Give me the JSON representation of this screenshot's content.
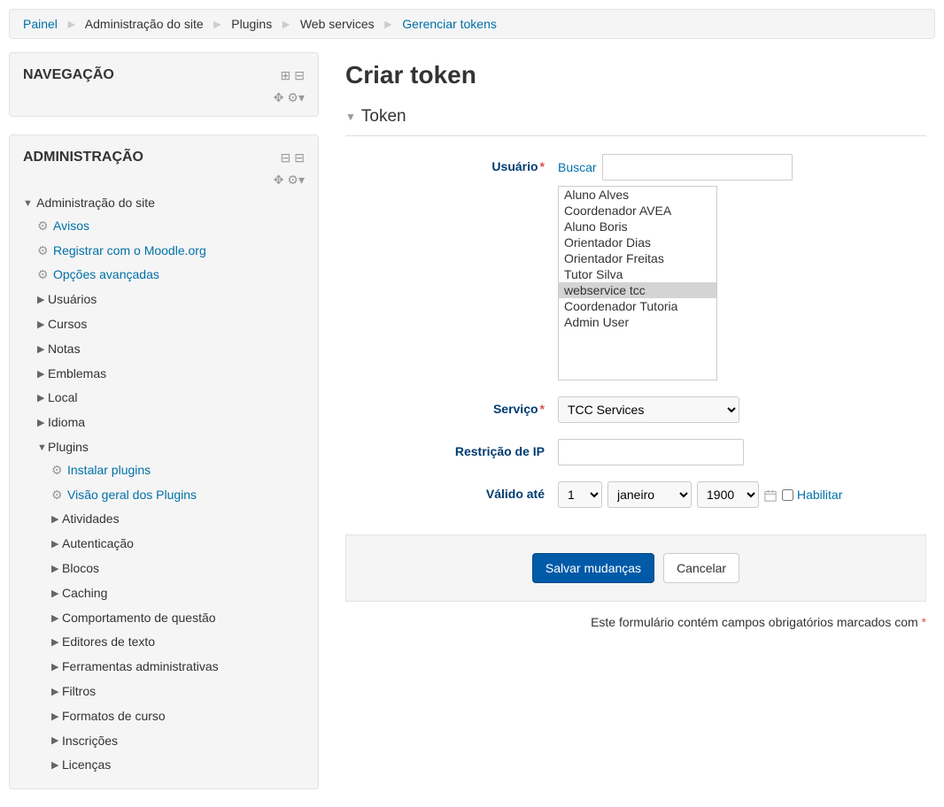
{
  "breadcrumb": [
    {
      "label": "Painel",
      "link": true
    },
    {
      "label": "Administração do site",
      "link": false
    },
    {
      "label": "Plugins",
      "link": false
    },
    {
      "label": "Web services",
      "link": false
    },
    {
      "label": "Gerenciar tokens",
      "link": true
    }
  ],
  "blocks": {
    "navigation": {
      "title": "NAVEGAÇÃO"
    },
    "administration": {
      "title": "ADMINISTRAÇÃO"
    }
  },
  "admin_tree": {
    "root": "Administração do site",
    "items": [
      {
        "label": "Avisos",
        "type": "gear",
        "link": true
      },
      {
        "label": "Registrar com o Moodle.org",
        "type": "gear",
        "link": true
      },
      {
        "label": "Opções avançadas",
        "type": "gear",
        "link": true
      },
      {
        "label": "Usuários",
        "type": "branch",
        "link": false
      },
      {
        "label": "Cursos",
        "type": "branch",
        "link": false
      },
      {
        "label": "Notas",
        "type": "branch",
        "link": false
      },
      {
        "label": "Emblemas",
        "type": "branch",
        "link": false
      },
      {
        "label": "Local",
        "type": "branch",
        "link": false
      },
      {
        "label": "Idioma",
        "type": "branch",
        "link": false
      }
    ],
    "plugins_label": "Plugins",
    "plugins_children": [
      {
        "label": "Instalar plugins",
        "type": "gear",
        "link": true
      },
      {
        "label": "Visão geral dos Plugins",
        "type": "gear",
        "link": true
      },
      {
        "label": "Atividades",
        "type": "branch",
        "link": false
      },
      {
        "label": "Autenticação",
        "type": "branch",
        "link": false
      },
      {
        "label": "Blocos",
        "type": "branch",
        "link": false
      },
      {
        "label": "Caching",
        "type": "branch",
        "link": false
      },
      {
        "label": "Comportamento de questão",
        "type": "branch",
        "link": false
      },
      {
        "label": "Editores de texto",
        "type": "branch",
        "link": false
      },
      {
        "label": "Ferramentas administrativas",
        "type": "branch",
        "link": false
      },
      {
        "label": "Filtros",
        "type": "branch",
        "link": false
      },
      {
        "label": "Formatos de curso",
        "type": "branch",
        "link": false
      },
      {
        "label": "Inscrições",
        "type": "branch",
        "link": false
      },
      {
        "label": "Licenças",
        "type": "branch",
        "link": false
      }
    ]
  },
  "page": {
    "title": "Criar token",
    "section": "Token"
  },
  "form": {
    "user_label": "Usuário",
    "search_label": "Buscar",
    "search_value": "",
    "users": [
      {
        "name": "Aluno Alves",
        "selected": false
      },
      {
        "name": "Coordenador AVEA",
        "selected": false
      },
      {
        "name": "Aluno Boris",
        "selected": false
      },
      {
        "name": "Orientador Dias",
        "selected": false
      },
      {
        "name": "Orientador Freitas",
        "selected": false
      },
      {
        "name": "Tutor Silva",
        "selected": false
      },
      {
        "name": "webservice tcc",
        "selected": true
      },
      {
        "name": "Coordenador Tutoria",
        "selected": false
      },
      {
        "name": "Admin User",
        "selected": false
      }
    ],
    "service_label": "Serviço",
    "service_value": "TCC Services",
    "ip_label": "Restrição de IP",
    "ip_value": "",
    "valid_label": "Válido até",
    "valid_day": "1",
    "valid_month": "janeiro",
    "valid_year": "1900",
    "enable_label": "Habilitar",
    "submit": "Salvar mudanças",
    "cancel": "Cancelar",
    "required_note": "Este formulário contém campos obrigatórios marcados com "
  }
}
